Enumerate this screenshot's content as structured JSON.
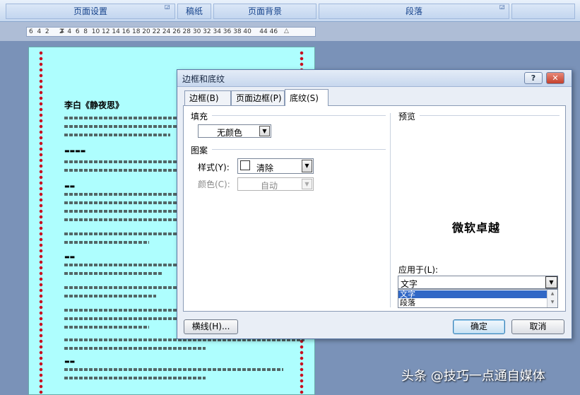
{
  "ribbon": {
    "groups": [
      "页面设置",
      "稿纸",
      "页面背景",
      "段落"
    ]
  },
  "ruler": {
    "numbers": "6  4  2     2  4  6  8  10 12 14 16 18 20 22 24 26 28 30 32 34 36 38 40    44 46"
  },
  "document": {
    "title": "李白《静夜思》"
  },
  "dialog": {
    "title": "边框和底纹",
    "help": "?",
    "close": "✕",
    "tabs": [
      "边框(B)",
      "页面边框(P)",
      "底纹(S)"
    ],
    "fill": {
      "label": "填充",
      "value": "无颜色"
    },
    "pattern": {
      "label": "图案",
      "style_label": "样式(Y):",
      "style_value": "清除",
      "color_label": "颜色(C):",
      "color_value": "自动"
    },
    "preview": {
      "label": "预览",
      "sample_text": "微软卓越"
    },
    "apply_to": {
      "label": "应用于(L):",
      "value": "文字",
      "options": [
        "文字",
        "段落"
      ]
    },
    "buttons": {
      "horizontal_line": "横线(H)...",
      "ok": "确定",
      "cancel": "取消"
    }
  },
  "watermark": "头条 @技巧一点通自媒体",
  "colors": {
    "page_background": "#aefefe",
    "border_dots": "#c81020",
    "selection": "#3168c6"
  }
}
